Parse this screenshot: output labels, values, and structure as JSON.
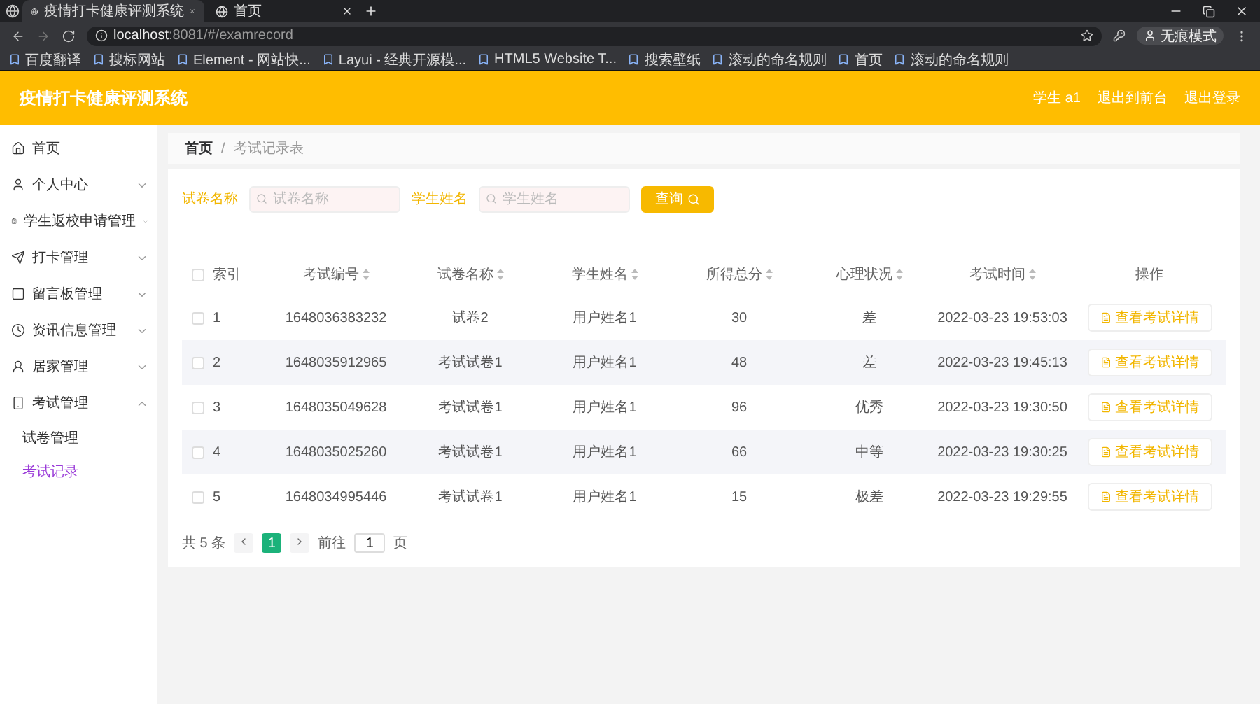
{
  "browser": {
    "tabs": [
      {
        "title": "疫情打卡健康评测系统",
        "selected": true
      },
      {
        "title": "首页",
        "selected": false
      }
    ],
    "url": {
      "host": "localhost",
      "rest": ":8081/#/examrecord"
    },
    "profile": "无痕模式",
    "bookmarks": [
      "百度翻译",
      "搜标网站",
      "Element - 网站快...",
      "Layui - 经典开源模...",
      "HTML5 Website T...",
      "搜索壁纸",
      "滚动的命名规则",
      "首页",
      "滚动的命名规则"
    ]
  },
  "header": {
    "title": "疫情打卡健康评测系统",
    "links": [
      "学生 a1",
      "退出到前台",
      "退出登录"
    ]
  },
  "sidebar": {
    "items": [
      {
        "label": "首页",
        "kind": "link"
      },
      {
        "label": "个人中心",
        "kind": "group",
        "expanded": false
      },
      {
        "label": "学生返校申请管理",
        "kind": "group",
        "expanded": false
      },
      {
        "label": "打卡管理",
        "kind": "group",
        "expanded": false
      },
      {
        "label": "留言板管理",
        "kind": "group",
        "expanded": false
      },
      {
        "label": "资讯信息管理",
        "kind": "group",
        "expanded": false
      },
      {
        "label": "居家管理",
        "kind": "group",
        "expanded": false
      },
      {
        "label": "考试管理",
        "kind": "group",
        "expanded": true,
        "children": [
          {
            "label": "试卷管理",
            "selected": false
          },
          {
            "label": "考试记录",
            "selected": true
          }
        ]
      }
    ]
  },
  "breadcrumb": {
    "separator": "/",
    "items": [
      "首页",
      "考试记录表"
    ]
  },
  "search": {
    "fields": [
      {
        "label": "试卷名称",
        "placeholder": "试卷名称"
      },
      {
        "label": "学生姓名",
        "placeholder": "学生姓名"
      }
    ],
    "button": "查询"
  },
  "table": {
    "all_checked": false,
    "columns": [
      {
        "label": "索引",
        "sortable": false
      },
      {
        "label": "考试编号",
        "sortable": true
      },
      {
        "label": "试卷名称",
        "sortable": true
      },
      {
        "label": "学生姓名",
        "sortable": true
      },
      {
        "label": "所得总分",
        "sortable": true
      },
      {
        "label": "心理状况",
        "sortable": true
      },
      {
        "label": "考试时间",
        "sortable": true
      },
      {
        "label": "操作",
        "sortable": false
      }
    ],
    "rows": [
      {
        "checked": false,
        "cells": [
          "1",
          "1648036383232",
          "试卷2",
          "用户姓名1",
          "30",
          "差",
          "2022-03-23 19:53:03"
        ],
        "action": "查看考试详情"
      },
      {
        "checked": false,
        "cells": [
          "2",
          "1648035912965",
          "考试试卷1",
          "用户姓名1",
          "48",
          "差",
          "2022-03-23 19:45:13"
        ],
        "action": "查看考试详情"
      },
      {
        "checked": false,
        "cells": [
          "3",
          "1648035049628",
          "考试试卷1",
          "用户姓名1",
          "96",
          "优秀",
          "2022-03-23 19:30:50"
        ],
        "action": "查看考试详情"
      },
      {
        "checked": false,
        "cells": [
          "4",
          "1648035025260",
          "考试试卷1",
          "用户姓名1",
          "66",
          "中等",
          "2022-03-23 19:30:25"
        ],
        "action": "查看考试详情"
      },
      {
        "checked": false,
        "cells": [
          "5",
          "1648034995446",
          "考试试卷1",
          "用户姓名1",
          "15",
          "极差",
          "2022-03-23 19:29:55"
        ],
        "action": "查看考试详情"
      }
    ]
  },
  "pagination": {
    "total": "共 5 条",
    "pages": [
      {
        "label": "1",
        "selected": true
      }
    ],
    "goto": "前往",
    "page_value": "1",
    "page_unit": "页"
  }
}
